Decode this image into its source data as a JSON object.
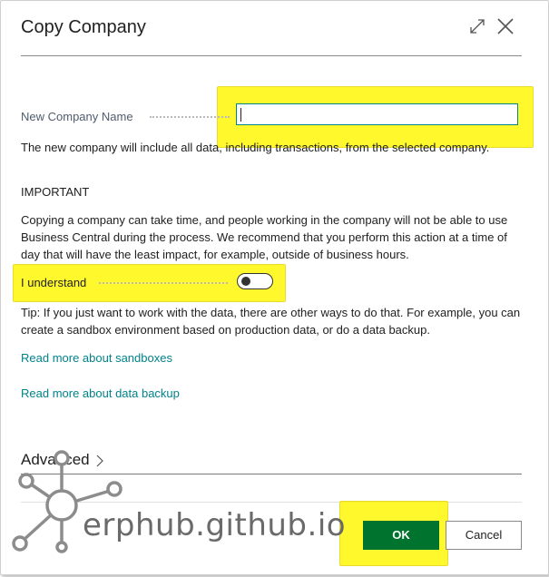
{
  "dialog": {
    "title": "Copy Company"
  },
  "form": {
    "new_company_name_label": "New Company Name",
    "new_company_name_value": "",
    "info_text": "The new company will include all data, including transactions, from the selected company.",
    "important_heading": "IMPORTANT",
    "important_text": "Copying a company can take time, and people working in the company will not be able to use Business Central during the process. We recommend that you perform this action at a time of day that will have the least impact, for example, outside of business hours.",
    "understand_label": "I understand",
    "understand_checked": false,
    "tip_text": "Tip: If you just want to work with the data, there are other ways to do that. For example, you can create a sandbox environment based on production data, or do a data backup.",
    "link_sandboxes": "Read more about sandboxes",
    "link_backup": "Read more about data backup"
  },
  "advanced": {
    "label": "Advanced"
  },
  "buttons": {
    "ok": "OK",
    "cancel": "Cancel"
  },
  "watermark": {
    "text": "erphub.github.io"
  },
  "icons": {
    "expand": "expand-icon",
    "close": "close-icon",
    "chevron": "chevron-right-icon",
    "logo": "network-hub-logo-icon"
  },
  "colors": {
    "accent": "#008489",
    "link": "#00838a",
    "primary_button": "#00742f",
    "highlight": "#fff700"
  }
}
